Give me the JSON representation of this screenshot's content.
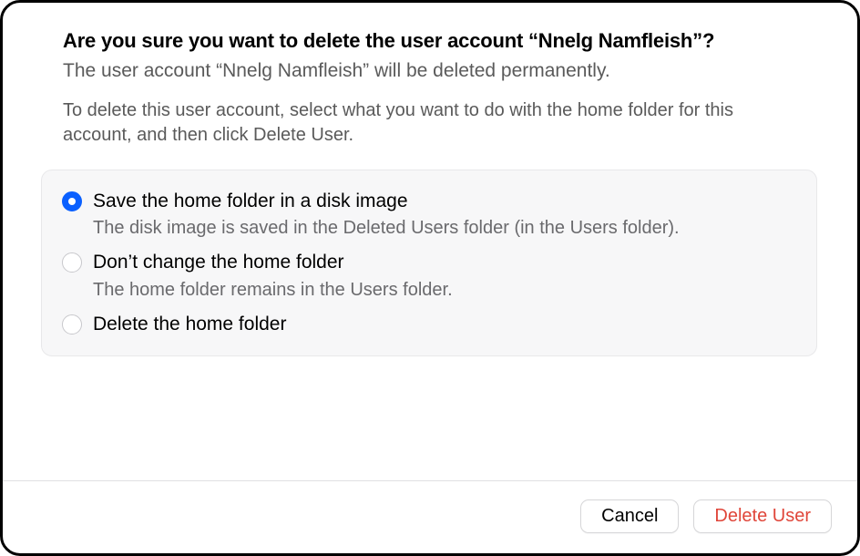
{
  "header": {
    "title": "Are you sure you want to delete the user account “Nnelg Namfleish”?",
    "subtitle": "The user account “Nnelg Namfleish” will be deleted permanently.",
    "instruction": "To delete this user account, select what you want to do with the home folder for this account, and then click Delete User."
  },
  "options": [
    {
      "label": "Save the home folder in a disk image",
      "description": "The disk image is saved in the Deleted Users folder (in the Users folder).",
      "selected": true
    },
    {
      "label": "Don’t change the home folder",
      "description": "The home folder remains in the Users folder.",
      "selected": false
    },
    {
      "label": "Delete the home folder",
      "description": "",
      "selected": false
    }
  ],
  "buttons": {
    "cancel": "Cancel",
    "delete": "Delete User"
  }
}
